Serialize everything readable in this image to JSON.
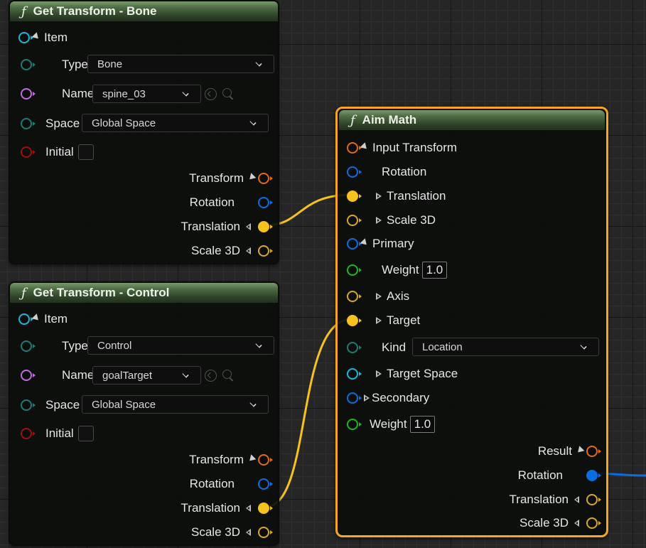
{
  "nodes": {
    "bone": {
      "title": "Get Transform - Bone",
      "item_label": "Item",
      "type_label": "Type",
      "type_value": "Bone",
      "name_label": "Name",
      "name_value": "spine_03",
      "space_label": "Space",
      "space_value": "Global Space",
      "initial_label": "Initial",
      "out_transform": "Transform",
      "out_rotation": "Rotation",
      "out_translation": "Translation",
      "out_scale": "Scale 3D"
    },
    "control": {
      "title": "Get Transform - Control",
      "item_label": "Item",
      "type_label": "Type",
      "type_value": "Control",
      "name_label": "Name",
      "name_value": "goalTarget",
      "space_label": "Space",
      "space_value": "Global Space",
      "initial_label": "Initial",
      "out_transform": "Transform",
      "out_rotation": "Rotation",
      "out_translation": "Translation",
      "out_scale": "Scale 3D"
    },
    "aim": {
      "title": "Aim Math",
      "input_transform": "Input Transform",
      "rotation": "Rotation",
      "translation": "Translation",
      "scale": "Scale 3D",
      "primary": "Primary",
      "primary_weight_label": "Weight",
      "primary_weight_value": "1.0",
      "axis": "Axis",
      "target": "Target",
      "kind_label": "Kind",
      "kind_value": "Location",
      "target_space": "Target Space",
      "secondary": "Secondary",
      "weight_label": "Weight",
      "weight_value": "1.0",
      "result": "Result",
      "out_rotation": "Rotation",
      "out_translation": "Translation",
      "out_scale": "Scale 3D"
    }
  },
  "icons": {
    "function": "function-icon",
    "use_selected": "use-selected-arrow-icon",
    "browse": "search-icon"
  },
  "colors": {
    "wire_vector": "#f6c21c",
    "wire_rotation": "#0a6ee0",
    "selection": "#f5a623",
    "header": "#4f6d45"
  }
}
